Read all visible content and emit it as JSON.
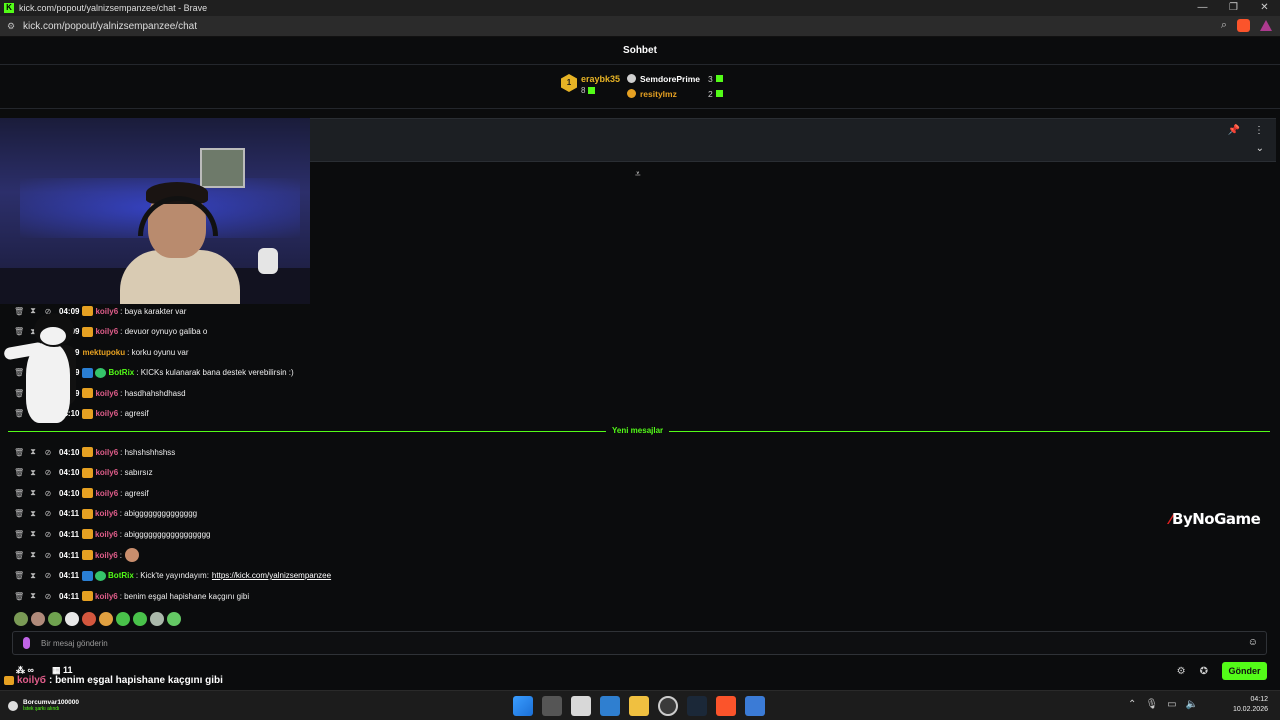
{
  "window": {
    "title": "kick.com/popout/yalnizsempanzee/chat - Brave",
    "url": "kick.com/popout/yalnizsempanzee/chat",
    "controls": [
      "—",
      "❐",
      "✕"
    ]
  },
  "chat": {
    "header": "Sohbet",
    "leaderboard": {
      "first": {
        "rank": "1",
        "name": "eraybk35",
        "count": "8"
      },
      "others": [
        {
          "name": "SemdorePrime",
          "count": "3",
          "color": "#ffffff"
        },
        {
          "name": "resitylmz",
          "count": "2",
          "color": "#e6a122"
        }
      ]
    },
    "new_messages_label": "Yeni mesajlar",
    "messages_before": [
      {
        "time": "04:09",
        "user": "koily6",
        "user_color": "#e05d8a",
        "badge": "sub",
        "text": ": baya karakter var"
      },
      {
        "time": "04:09",
        "user": "koily6",
        "user_color": "#e05d8a",
        "badge": "sub",
        "text": ": devuor oynuyo galiba o"
      },
      {
        "time": "04:09",
        "user": "mektupoku",
        "user_color": "#e6a122",
        "badge": "",
        "text": ": korku oyunu var"
      },
      {
        "time": "04:09",
        "user": "BotRix",
        "user_color": "#53fc18",
        "badge": "bot",
        "text": ": KICKs kulanarak bana destek verebilirsin :)"
      },
      {
        "time": "04:09",
        "user": "koily6",
        "user_color": "#e05d8a",
        "badge": "sub",
        "text": ": hasdhahshdhasd"
      },
      {
        "time": "04:10",
        "user": "koily6",
        "user_color": "#e05d8a",
        "badge": "sub",
        "text": ": agresif"
      }
    ],
    "messages_after": [
      {
        "time": "04:10",
        "user": "koily6",
        "user_color": "#e05d8a",
        "badge": "sub",
        "text": ": hshshshhshss"
      },
      {
        "time": "04:10",
        "user": "koily6",
        "user_color": "#e05d8a",
        "badge": "sub",
        "text": ": sabırsız"
      },
      {
        "time": "04:10",
        "user": "koily6",
        "user_color": "#e05d8a",
        "badge": "sub",
        "text": ": agresif"
      },
      {
        "time": "04:11",
        "user": "koily6",
        "user_color": "#e05d8a",
        "badge": "sub",
        "text": ": abigggggggggggggg"
      },
      {
        "time": "04:11",
        "user": "koily6",
        "user_color": "#e05d8a",
        "badge": "sub",
        "text": ": abiggggggggggggggggg"
      },
      {
        "time": "04:11",
        "user": "koily6",
        "user_color": "#e05d8a",
        "badge": "sub",
        "text": ":"
      },
      {
        "time": "04:11",
        "user": "BotRix",
        "user_color": "#53fc18",
        "badge": "bot",
        "text": ": Kick'te yayındayım:",
        "link": "https://kick.com/yalnizsempanzee"
      },
      {
        "time": "04:11",
        "user": "koily6",
        "user_color": "#e05d8a",
        "badge": "sub",
        "text": ": benim eşgal hapishane kaçgını gibi"
      }
    ],
    "input_placeholder": "Bir mesaj gönderin",
    "send_label": "Gönder",
    "footer": {
      "infinity": "∞",
      "calendar_count": "11"
    }
  },
  "overlay": {
    "user": "koilyб",
    "text": ": benim eşgal hapishane kaçgını gibi"
  },
  "watermark": "ByNoGame",
  "taskbar": {
    "status_title": "Borcumvar100000",
    "status_sub": "İstek şarkı alındı",
    "time": "04:12",
    "date": "10.02.2026"
  }
}
